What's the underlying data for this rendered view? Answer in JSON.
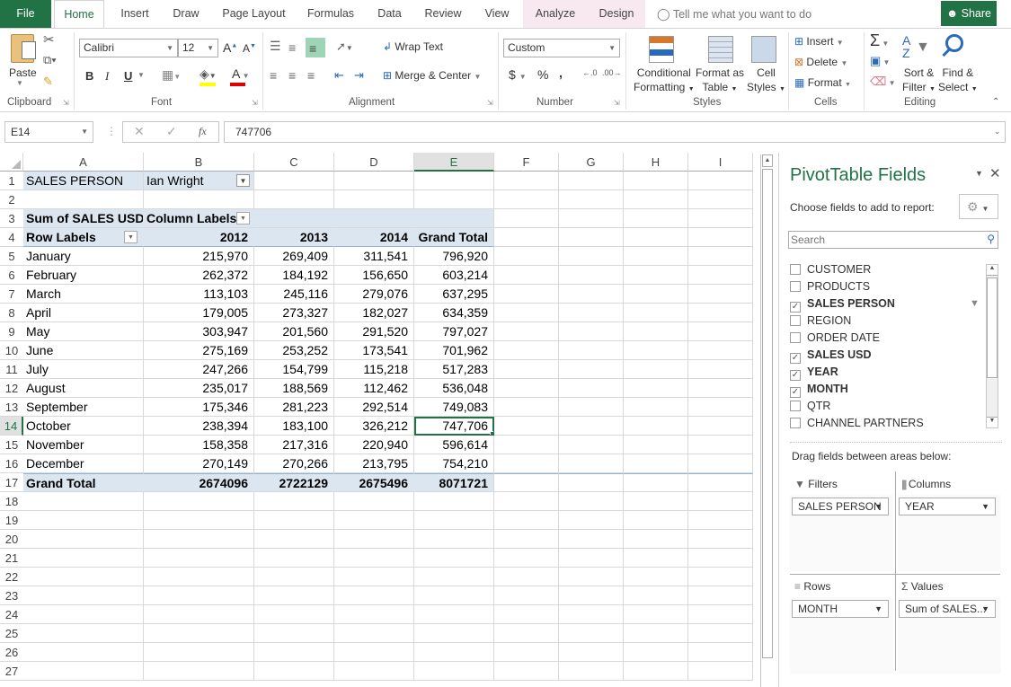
{
  "tabs": {
    "file": "File",
    "items": [
      "Home",
      "Insert",
      "Draw",
      "Page Layout",
      "Formulas",
      "Data",
      "Review",
      "View"
    ],
    "contextual": [
      "Analyze",
      "Design"
    ],
    "tell_me": "Tell me what you want to do",
    "share": "Share"
  },
  "ribbon": {
    "clipboard": {
      "label": "Clipboard",
      "paste": "Paste"
    },
    "font": {
      "label": "Font",
      "name": "Calibri",
      "size": "12",
      "bold": "B",
      "italic": "I",
      "underline": "U"
    },
    "alignment": {
      "label": "Alignment",
      "wrap_text": "Wrap Text",
      "merge_center": "Merge & Center"
    },
    "number": {
      "label": "Number",
      "format": "Custom",
      "currency": "$",
      "percent": "%",
      "comma": ","
    },
    "styles": {
      "label": "Styles",
      "conditional_1": "Conditional",
      "conditional_2": "Formatting",
      "format_table_1": "Format as",
      "format_table_2": "Table",
      "cell_styles_1": "Cell",
      "cell_styles_2": "Styles"
    },
    "cells": {
      "label": "Cells",
      "insert": "Insert",
      "delete": "Delete",
      "format": "Format"
    },
    "editing": {
      "label": "Editing",
      "sort_1": "Sort &",
      "sort_2": "Filter",
      "find_1": "Find &",
      "find_2": "Select"
    }
  },
  "formula_bar": {
    "name_box": "E14",
    "fx": "fx",
    "value": "747706"
  },
  "sheet": {
    "columns": [
      "A",
      "B",
      "C",
      "D",
      "E",
      "F",
      "G",
      "H",
      "I"
    ],
    "rows": [
      "1",
      "2",
      "3",
      "4",
      "5",
      "6",
      "7",
      "8",
      "9",
      "10",
      "11",
      "12",
      "13",
      "14",
      "15",
      "16",
      "17",
      "18",
      "19",
      "20",
      "21",
      "22",
      "23",
      "24",
      "25",
      "26",
      "27"
    ],
    "filter_label": "SALES PERSON",
    "filter_value": "Ian Wright",
    "values_header": "Sum of SALES USD",
    "column_labels": "Column Labels",
    "row_labels": "Row Labels",
    "year_headers": [
      "2012",
      "2013",
      "2014",
      "Grand Total"
    ],
    "data": [
      {
        "month": "January",
        "v": [
          "215,970",
          "269,409",
          "311,541",
          "796,920"
        ]
      },
      {
        "month": "February",
        "v": [
          "262,372",
          "184,192",
          "156,650",
          "603,214"
        ]
      },
      {
        "month": "March",
        "v": [
          "113,103",
          "245,116",
          "279,076",
          "637,295"
        ]
      },
      {
        "month": "April",
        "v": [
          "179,005",
          "273,327",
          "182,027",
          "634,359"
        ]
      },
      {
        "month": "May",
        "v": [
          "303,947",
          "201,560",
          "291,520",
          "797,027"
        ]
      },
      {
        "month": "June",
        "v": [
          "275,169",
          "253,252",
          "173,541",
          "701,962"
        ]
      },
      {
        "month": "July",
        "v": [
          "247,266",
          "154,799",
          "115,218",
          "517,283"
        ]
      },
      {
        "month": "August",
        "v": [
          "235,017",
          "188,569",
          "112,462",
          "536,048"
        ]
      },
      {
        "month": "September",
        "v": [
          "175,346",
          "281,223",
          "292,514",
          "749,083"
        ]
      },
      {
        "month": "October",
        "v": [
          "238,394",
          "183,100",
          "326,212",
          "747,706"
        ]
      },
      {
        "month": "November",
        "v": [
          "158,358",
          "217,316",
          "220,940",
          "596,614"
        ]
      },
      {
        "month": "December",
        "v": [
          "270,149",
          "270,266",
          "213,795",
          "754,210"
        ]
      }
    ],
    "grand_total_label": "Grand Total",
    "grand_total": [
      "2674096",
      "2722129",
      "2675496",
      "8071721"
    ],
    "selected_cell": "E14"
  },
  "pivot_pane": {
    "title": "PivotTable Fields",
    "choose_label": "Choose fields to add to report:",
    "search_placeholder": "Search",
    "fields": [
      {
        "name": "CUSTOMER",
        "checked": false
      },
      {
        "name": "PRODUCTS",
        "checked": false
      },
      {
        "name": "SALES PERSON",
        "checked": true,
        "filtered": true
      },
      {
        "name": "REGION",
        "checked": false
      },
      {
        "name": "ORDER DATE",
        "checked": false
      },
      {
        "name": "SALES USD",
        "checked": true
      },
      {
        "name": "YEAR",
        "checked": true
      },
      {
        "name": "MONTH",
        "checked": true
      },
      {
        "name": "QTR",
        "checked": false
      },
      {
        "name": "CHANNEL PARTNERS",
        "checked": false
      }
    ],
    "drag_label": "Drag fields between areas below:",
    "areas": {
      "filters": {
        "label": "Filters",
        "item": "SALES PERSON"
      },
      "columns": {
        "label": "Columns",
        "item": "YEAR"
      },
      "rows": {
        "label": "Rows",
        "item": "MONTH"
      },
      "values": {
        "label": "Values",
        "item": "Sum of SALES..."
      }
    }
  }
}
